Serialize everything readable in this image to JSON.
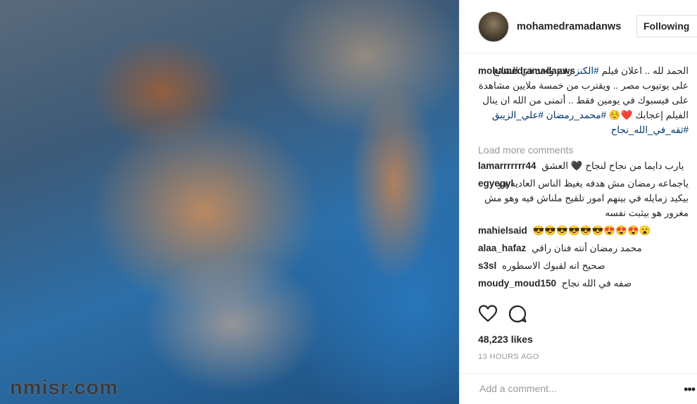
{
  "photo": {
    "watermark": "nmisr.com"
  },
  "header": {
    "username": "mohamedramadanws",
    "follow_label": "Following"
  },
  "caption": {
    "author": "mohamedramadanws",
    "text_1": "الحمد لله .. اعلان فيلم",
    "tag_1": "#الكنز",
    "text_2": "رقم واحد في الشائع على يوتيوب مصر .. ويقترب من خمسة ملايين مشاهدة على فيسبوك في يومين فقط .. أتمنى من الله ان ينال الفيلم إعجابك ❤️☺️",
    "tag_2": "#محمد_رمضان",
    "tag_3": "#علي_الزيبق",
    "tag_4": "#ثقه_في_الله_نجاح"
  },
  "load_more": "Load more comments",
  "comments": [
    {
      "user": "lamarrrrrrr44",
      "text": "يارب دايما من نجاح لنجاح 🖤 العشق"
    },
    {
      "user": "egyegyl",
      "text": "ياجماعه رمضان مش هدفه يغيظ الناس العاديه هو بيكيد زمايله في بينهم امور تلقيح ملناش فيه وهو مش مغرور هو بيثبت نفسه"
    },
    {
      "user": "mahielsaid",
      "text": "😮😍😍😍😎😎😎😎😎😎"
    },
    {
      "user": "alaa_hafaz",
      "text": "محمد رمضان أنته فنان راقي"
    },
    {
      "user": "s3sl",
      "text": "صحيح انه لقبوك الاسطوره"
    },
    {
      "user": "moudy_moud150",
      "text": "صفه في الله نجاح"
    }
  ],
  "likes": "48,223 likes",
  "timestamp": "13 HOURS AGO",
  "add_comment": {
    "placeholder": "Add a comment..."
  },
  "more_label": "•••"
}
